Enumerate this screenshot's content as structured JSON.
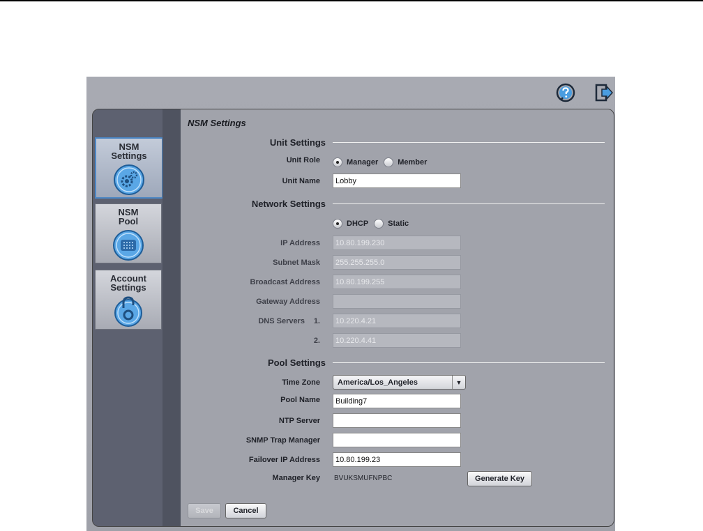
{
  "header": {
    "help_icon": "help-icon",
    "logout_icon": "logout-icon"
  },
  "sidebar": {
    "items": [
      {
        "label": "NSM\nSettings",
        "icon": "gears-icon",
        "active": true
      },
      {
        "label": "NSM\nPool",
        "icon": "pool-icon",
        "active": false
      },
      {
        "label": "Account\nSettings",
        "icon": "lock-icon",
        "active": false
      }
    ]
  },
  "page": {
    "title": "NSM Settings"
  },
  "unit_settings": {
    "heading": "Unit Settings",
    "unit_role_label": "Unit Role",
    "role_manager": "Manager",
    "role_member": "Member",
    "selected_role": "Manager",
    "unit_name_label": "Unit Name",
    "unit_name_value": "Lobby"
  },
  "network_settings": {
    "heading": "Network Settings",
    "mode_dhcp": "DHCP",
    "mode_static": "Static",
    "selected_mode": "DHCP",
    "ip_label": "IP Address",
    "ip_value": "10.80.199.230",
    "subnet_label": "Subnet Mask",
    "subnet_value": "255.255.255.0",
    "broadcast_label": "Broadcast Address",
    "broadcast_value": "10.80.199.255",
    "gateway_label": "Gateway Address",
    "gateway_value": "",
    "dns_label": "DNS Servers",
    "dns1_index": "1.",
    "dns1_value": "10.220.4.21",
    "dns2_index": "2.",
    "dns2_value": "10.220.4.41"
  },
  "pool_settings": {
    "heading": "Pool Settings",
    "timezone_label": "Time Zone",
    "timezone_value": "America/Los_Angeles",
    "pool_name_label": "Pool Name",
    "pool_name_value": "Building7",
    "ntp_label": "NTP Server",
    "ntp_value": "",
    "snmp_label": "SNMP Trap Manager",
    "snmp_value": "",
    "failover_label": "Failover IP Address",
    "failover_value": "10.80.199.23",
    "manager_key_label": "Manager Key",
    "manager_key_value": "BVUKSMUFNPBC",
    "generate_key_label": "Generate Key"
  },
  "footer": {
    "save_label": "Save",
    "cancel_label": "Cancel"
  },
  "colors": {
    "accent": "#4c86c4",
    "icon_blue": "#3b8fd6"
  }
}
